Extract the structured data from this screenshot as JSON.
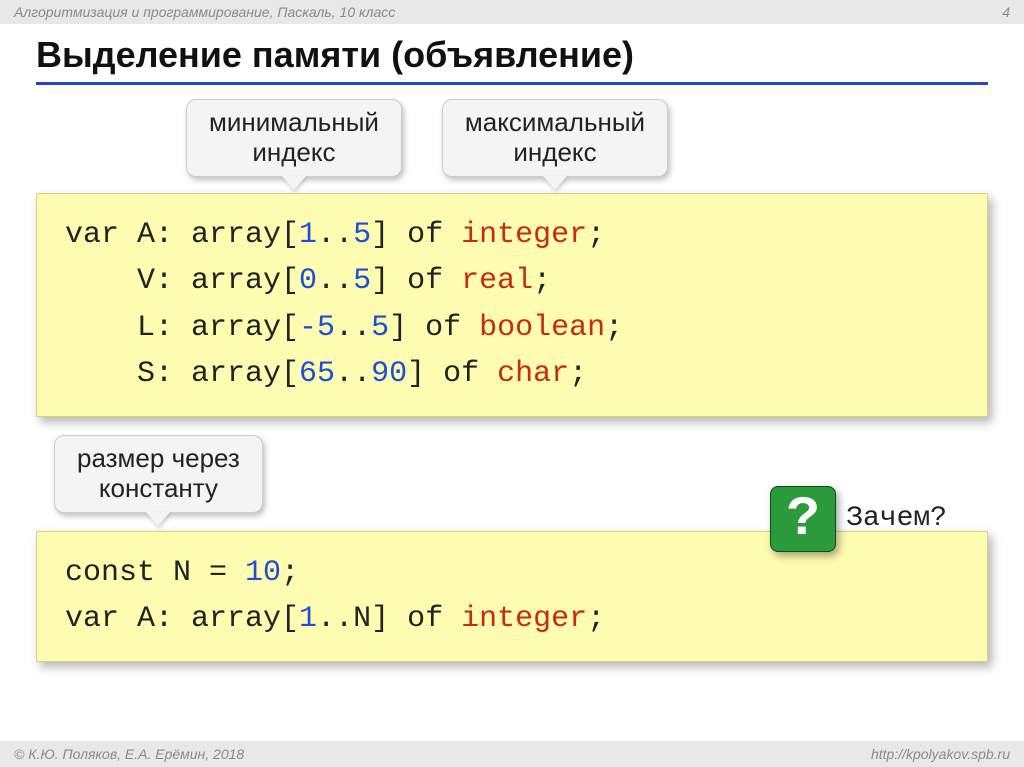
{
  "topbar": {
    "left": "Алгоритмизация и программирование, Паскаль, 10 класс",
    "page": "4"
  },
  "title": "Выделение памяти (объявление)",
  "callouts": {
    "min": "минимальный\nиндекс",
    "max": "максимальный\nиндекс",
    "const": "размер через\nконстанту"
  },
  "code1": {
    "l1_a": "var A: array[",
    "l1_n1": "1",
    "l1_dots": "..",
    "l1_n2": "5",
    "l1_b": "] of ",
    "l1_t": "integer",
    "l1_c": ";",
    "l2_a": "    V: array[",
    "l2_n1": "0",
    "l2_dots": "..",
    "l2_n2": "5",
    "l2_b": "] of ",
    "l2_t": "real",
    "l2_c": ";",
    "l3_a": "    L: array[",
    "l3_n1": "-5",
    "l3_dots": "..",
    "l3_n2": "5",
    "l3_b": "] of ",
    "l3_t": "boolean",
    "l3_c": ";",
    "l4_a": "    S: array[",
    "l4_n1": "65",
    "l4_dots": "..",
    "l4_n2": "90",
    "l4_b": "] of ",
    "l4_t": "char",
    "l4_c": ";"
  },
  "question": {
    "symbol": "?",
    "text": "Зачем?"
  },
  "code2": {
    "l1_a": "const N",
    "l1_eq": " = ",
    "l1_n": "10",
    "l1_c": ";",
    "l2_a": "var A: array[",
    "l2_n1": "1",
    "l2_dots": "..",
    "l2_n2": "N",
    "l2_b": "] of ",
    "l2_t": "integer",
    "l2_c": ";"
  },
  "footer": {
    "left": "© К.Ю. Поляков, Е.А. Ерёмин, 2018",
    "right": "http://kpolyakov.spb.ru"
  }
}
